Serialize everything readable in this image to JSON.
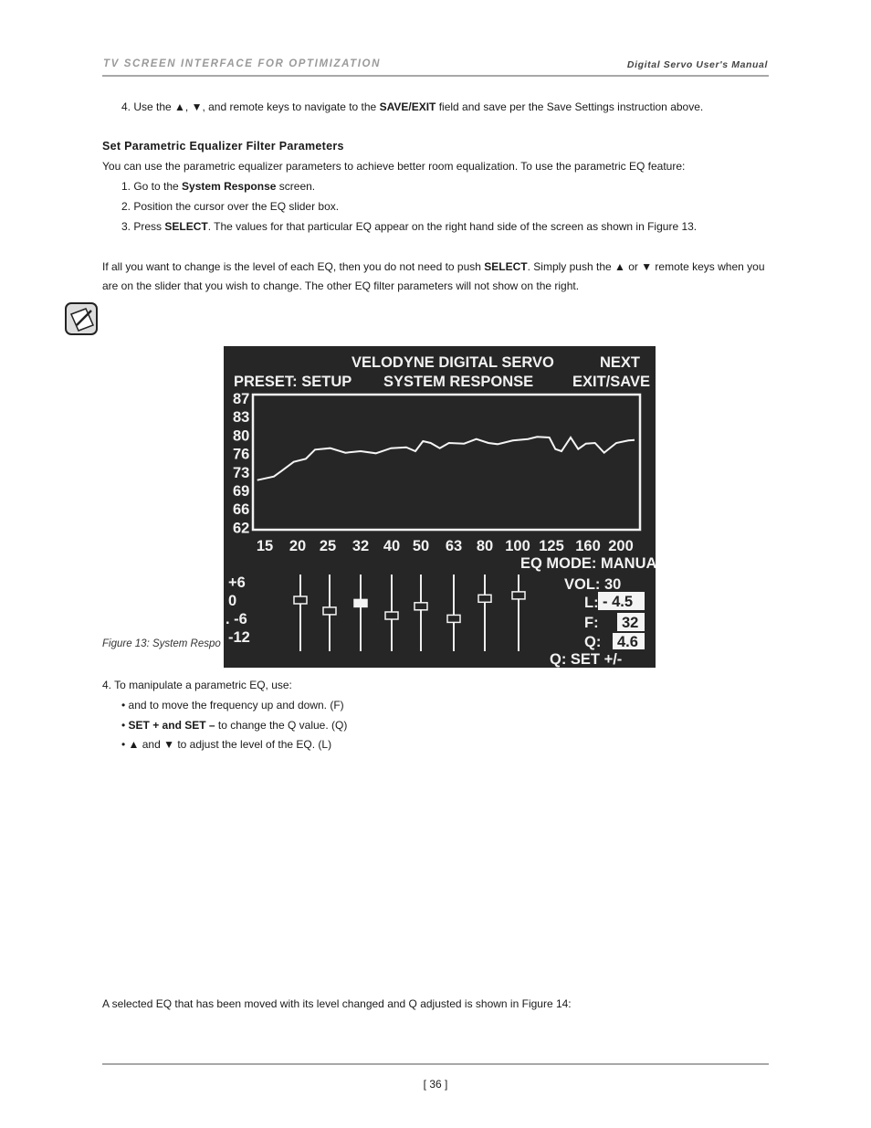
{
  "header": {
    "section": "TV SCREEN INTERFACE FOR OPTIMIZATION",
    "manual": "Digital Servo User's Manual"
  },
  "step4_top": {
    "a": "4. Use the ▲, ▼,     and     remote keys to navigate to the ",
    "b": "SAVE/EXIT",
    "c": " field and save per the Save Settings instruction above."
  },
  "section_title": "Set Parametric Equalizer Filter Parameters",
  "intro": "You can use the parametric equalizer parameters to achieve better room equalization. To use the parametric EQ feature:",
  "steps": [
    {
      "a": "1. Go to the ",
      "b": "System Response",
      "c": " screen."
    },
    {
      "a": "2. Position the cursor over the EQ slider box.",
      "b": "",
      "c": ""
    },
    {
      "a": "3. Press ",
      "b": "SELECT",
      "c": ". The values for that particular EQ appear on the right hand side of the screen as shown in Figure 13."
    }
  ],
  "para1": {
    "a": "If all you want to change is the level of each EQ, then you do not need to push ",
    "b": "SELECT",
    "c": ".  Simply push the ▲ or ▼ remote keys when you",
    "line2": "are on the slider that you wish to change. The other EQ filter parameters will not show on the right."
  },
  "note_icon": "note-pencil-icon",
  "figure": {
    "title": "VELODYNE DIGITAL SERVO",
    "subtitle": "SYSTEM RESPONSE",
    "preset": "PRESET: SETUP",
    "next": "NEXT",
    "exit_save": "EXIT/SAVE",
    "y_ticks": [
      "87",
      "83",
      "80",
      "76",
      "73",
      "69",
      "66",
      "62"
    ],
    "x_ticks": [
      "15",
      "20",
      "25",
      "32",
      "40",
      "50",
      "63",
      "80",
      "100",
      "125",
      "160",
      "200"
    ],
    "eq_mode": "EQ MODE: MANUAL",
    "level_ticks": [
      "+6",
      "0",
      ". -6",
      "-12"
    ],
    "slider_levels_db": [
      0,
      -3.5,
      -1,
      -5,
      -2,
      -6,
      0.5,
      1.5
    ],
    "selected_slider": 2,
    "vol": "VOL: 30",
    "l_label": "L:",
    "l_value": "- 4.5",
    "f_label": "F:",
    "f_value": "32",
    "q_label": "Q:",
    "q_value": "4.6",
    "q_set": "Q: SET +/-"
  },
  "caption": "Figure 13: System Respo",
  "step4": "4. To manipulate a parametric EQ, use:",
  "bullets": [
    {
      "a": "•      and      to move the frequency up and down. (F)",
      "b": "",
      "c": ""
    },
    {
      "a": "• ",
      "b": "SET + and SET –",
      "c": " to change the Q value. (Q)"
    },
    {
      "a": "• ▲ and ▼ to adjust the level of the EQ. (L)",
      "b": "",
      "c": ""
    }
  ],
  "para2": "A selected EQ that has been moved with its level changed and Q adjusted is shown in Figure 14:",
  "footer": {
    "page": "[ 36 ]"
  }
}
